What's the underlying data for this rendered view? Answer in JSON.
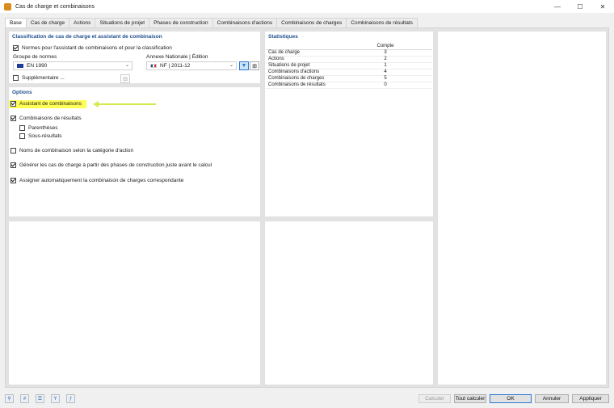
{
  "window": {
    "title": "Cas de charge et combinaisons",
    "controls": {
      "minimize": "—",
      "maximize": "☐",
      "close": "✕"
    }
  },
  "tabs": [
    {
      "label": "Base",
      "active": true
    },
    {
      "label": "Cas de charge"
    },
    {
      "label": "Actions"
    },
    {
      "label": "Situations de projet"
    },
    {
      "label": "Phases de construction"
    },
    {
      "label": "Combinaisons d'actions"
    },
    {
      "label": "Combinaisons de charges"
    },
    {
      "label": "Combinaisons de résultats"
    }
  ],
  "classification": {
    "title": "Classification de cas de charge et assistant de combinaison",
    "norms_checkbox": {
      "label": "Normes pour l'assistant de combinaisons et pour la classification",
      "checked": true
    },
    "group_label": "Groupe de normes",
    "group_value": "EN 1990",
    "annex_label": "Annexe Nationale | Édition",
    "annex_value": "NF | 2011-12",
    "supplementary": {
      "label": "Supplémentaire ...",
      "checked": false
    }
  },
  "options": {
    "title": "Options",
    "assistant": {
      "label": "Assistant de combinaisons",
      "checked": true
    },
    "result_combos": {
      "label": "Combinaisons de résultats",
      "checked": true
    },
    "parentheses": {
      "label": "Parenthèses",
      "checked": false
    },
    "subresults": {
      "label": "Sous-résultats",
      "checked": false
    },
    "names_by_category": {
      "label": "Noms de combinaison selon la catégorie d'action",
      "checked": false
    },
    "generate_lc": {
      "label": "Générer les cas de charge à partir des phases de construction juste avant le calcul",
      "checked": true
    },
    "auto_assign": {
      "label": "Assigner automatiquement la combinaison de charges correspondante",
      "checked": true
    }
  },
  "statistics": {
    "title": "Statistiques",
    "column_header": "Compte",
    "rows": [
      {
        "label": "Cas de charge",
        "count": "3"
      },
      {
        "label": "Actions",
        "count": "2"
      },
      {
        "label": "Situations de projet",
        "count": "1"
      },
      {
        "label": "Combinaisons d'actions",
        "count": "4"
      },
      {
        "label": "Combinaisons de charges",
        "count": "5"
      },
      {
        "label": "Combinaisons de résultats",
        "count": "0"
      }
    ]
  },
  "footer": {
    "icons": [
      "search-icon",
      "number-icon",
      "tree-icon",
      "filter-icon",
      "formula-icon"
    ],
    "buttons": {
      "calculate": "Calculer",
      "calculate_all": "Tout calculer",
      "ok": "OK",
      "cancel": "Annuler",
      "apply": "Appliquer"
    }
  }
}
